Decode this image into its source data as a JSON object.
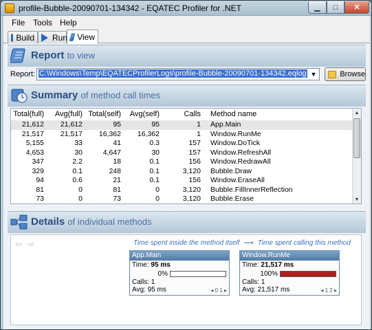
{
  "window": {
    "title": "profile-Bubble-20090701-134342 - EQATEC Profiler for .NET"
  },
  "menu": [
    {
      "label": "File"
    },
    {
      "label": "Tools"
    },
    {
      "label": "Help"
    }
  ],
  "tabs": [
    {
      "label": "Build",
      "icon": "build-icon"
    },
    {
      "label": "Run",
      "icon": "run-icon"
    },
    {
      "label": "View",
      "icon": "view-icon",
      "active": true
    }
  ],
  "report": {
    "heading": "Report",
    "heading_sub": "to view",
    "label": "Report:",
    "path": "C:\\Windows\\Temp\\EQATECProfilerLogs\\profile-Bubble-20090701-134342.eqlog",
    "browse_label": "Browse"
  },
  "summary": {
    "heading": "Summary",
    "heading_sub": "of method call times",
    "columns": [
      "Total(full)",
      "Avg(full)",
      "Total(self)",
      "Avg(self)",
      "Calls",
      "Method name"
    ],
    "rows": [
      [
        "21,612",
        "21,612",
        "95",
        "95",
        "1",
        "App.Main"
      ],
      [
        "21,517",
        "21,517",
        "16,362",
        "16,362",
        "1",
        "Window.RunMe"
      ],
      [
        "5,155",
        "33",
        "41",
        "0.3",
        "157",
        "Window.DoTick"
      ],
      [
        "4,653",
        "30",
        "4,647",
        "30",
        "157",
        "Window.RefreshAll"
      ],
      [
        "347",
        "2.2",
        "18",
        "0.1",
        "156",
        "Window.RedrawAll"
      ],
      [
        "329",
        "0.1",
        "248",
        "0.1",
        "3,120",
        "Bubble.Draw"
      ],
      [
        "94",
        "0.6",
        "21",
        "0.1",
        "156",
        "Window.EraseAll"
      ],
      [
        "81",
        "0",
        "81",
        "0",
        "3,120",
        "Bubble.FillInnerReflection"
      ],
      [
        "73",
        "0",
        "73",
        "0",
        "3,120",
        "Bubble.Erase"
      ]
    ]
  },
  "details": {
    "heading": "Details",
    "heading_sub": "of individual methods",
    "legend_left": "Time spent inside the method itself",
    "legend_arrow": "⟶",
    "legend_right": "Time spent calling this method",
    "cards": [
      {
        "title": "App.Main",
        "time_label": "Time:",
        "time": "95 ms",
        "pct": "0%",
        "pct_value": 0,
        "calls_label": "Calls:",
        "calls": "1",
        "avg_label": "Avg:",
        "avg": "95 ms",
        "nav": "◂ 0 1 ▸"
      },
      {
        "title": "Window.RunMe",
        "time_label": "Time:",
        "time": "21,517 ms",
        "pct": "100%",
        "pct_value": 100,
        "calls_label": "Calls:",
        "calls": "1",
        "avg_label": "Avg:",
        "avg": "21,517 ms",
        "nav": "◂ 1 2 ▸"
      }
    ]
  },
  "colors": {
    "accent": "#2a4e82",
    "bar_fill": "#b01f1f",
    "selected_row": "#e6e6e6"
  }
}
